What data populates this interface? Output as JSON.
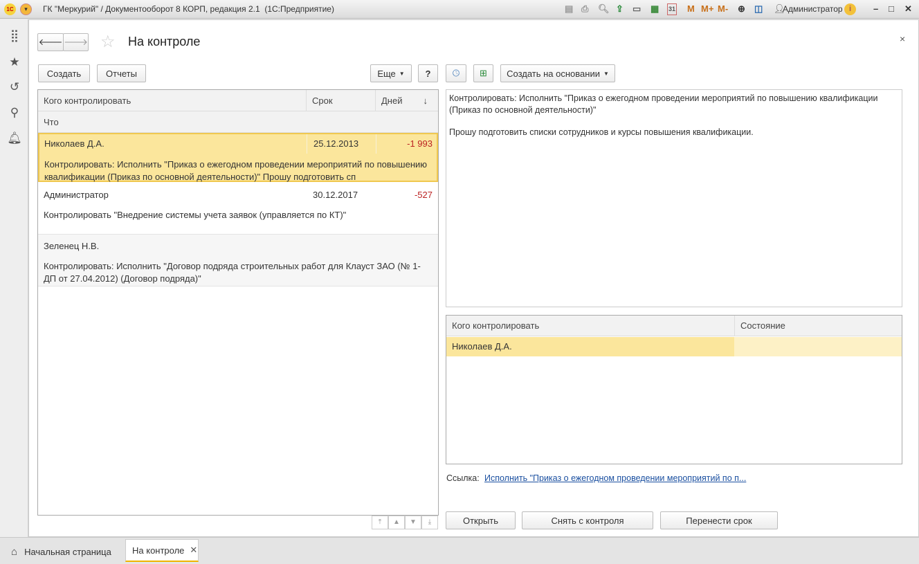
{
  "window": {
    "title": "ГК \"Меркурий\" / Документооборот 8 КОРП, редакция 2.1  (1С:Предприятие)",
    "user": "Администратор",
    "m": "M",
    "mplus": "M+",
    "mminus": "M-",
    "calendar_day": "31"
  },
  "form": {
    "title": "На контроле"
  },
  "left_toolbar": {
    "create": "Создать",
    "reports": "Отчеты",
    "more": "Еще",
    "help": "?"
  },
  "right_toolbar": {
    "create_based": "Создать на основании"
  },
  "list": {
    "columns": {
      "who": "Кого контролировать",
      "deadline": "Срок",
      "days": "Дней",
      "what": "Что"
    },
    "rows": [
      {
        "who": "Николаев Д.А.",
        "deadline": "25.12.2013",
        "days": "-1 993",
        "what": "Контролировать: Исполнить \"Приказ о ежегодном проведении мероприятий по повышению квалификации (Приказ по основной деятельности)\" Прошу подготовить сп"
      },
      {
        "who": "Администратор",
        "deadline": "30.12.2017",
        "days": "-527",
        "what": "Контролировать \"Внедрение системы учета заявок (управляется по КТ)\""
      },
      {
        "who": "Зеленец Н.В.",
        "deadline": "",
        "days": "",
        "what": "Контролировать: Исполнить \"Договор подряда строительных работ для Клауст ЗАО (№ 1-ДП от 27.04.2012) (Договор подряда)\""
      }
    ]
  },
  "detail": {
    "text1": "Контролировать: Исполнить \"Приказ о ежегодном проведении мероприятий по повышению квалификации (Приказ по основной деятельности)\"",
    "text2": "Прошу подготовить списки сотрудников и курсы повышения квалификации."
  },
  "controllers": {
    "columns": {
      "who": "Кого контролировать",
      "state": "Состояние"
    },
    "rows": [
      {
        "who": "Николаев Д.А.",
        "state": ""
      }
    ]
  },
  "link": {
    "label": "Ссылка:",
    "text": "Исполнить \"Приказ о ежегодном проведении мероприятий по п..."
  },
  "actions": {
    "open": "Открыть",
    "remove": "Снять с контроля",
    "postpone": "Перенести срок"
  },
  "tabs": [
    {
      "label": "Начальная страница"
    },
    {
      "label": "На контроле"
    }
  ],
  "colors": {
    "selection": "#fbe69c",
    "negative": "#b22222",
    "link": "#1a4fa0"
  }
}
